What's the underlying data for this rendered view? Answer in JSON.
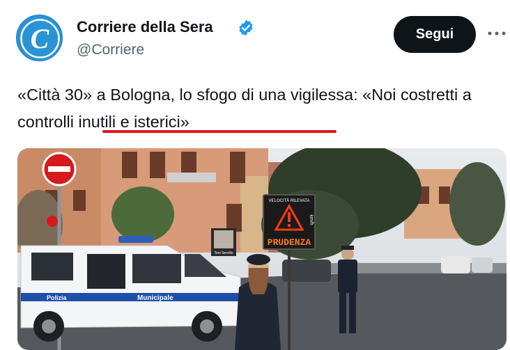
{
  "author": {
    "name": "Corriere della Sera",
    "handle": "@Corriere",
    "avatar_letter": "C",
    "verified_icon": "verified-badge-icon"
  },
  "actions": {
    "follow_label": "Segui",
    "more_icon": "more-options-icon"
  },
  "tweet": {
    "text": "«Città 30» a Bologna, lo sfogo di una vigilessa: «Noi costretti a controlli inutili e isterici»"
  },
  "photo": {
    "sign_header": "VELOCITÀ RILEVATA",
    "sign_unit": "km/h",
    "sign_word": "PRUDENZA",
    "vehicle_text_1": "Polizia",
    "vehicle_text_2": "Municipale",
    "poster_caption": "Toni Servillo"
  },
  "colors": {
    "brand_blue": "#1d9bf0",
    "follow_bg": "#0f1419",
    "underline": "#e0121b"
  }
}
